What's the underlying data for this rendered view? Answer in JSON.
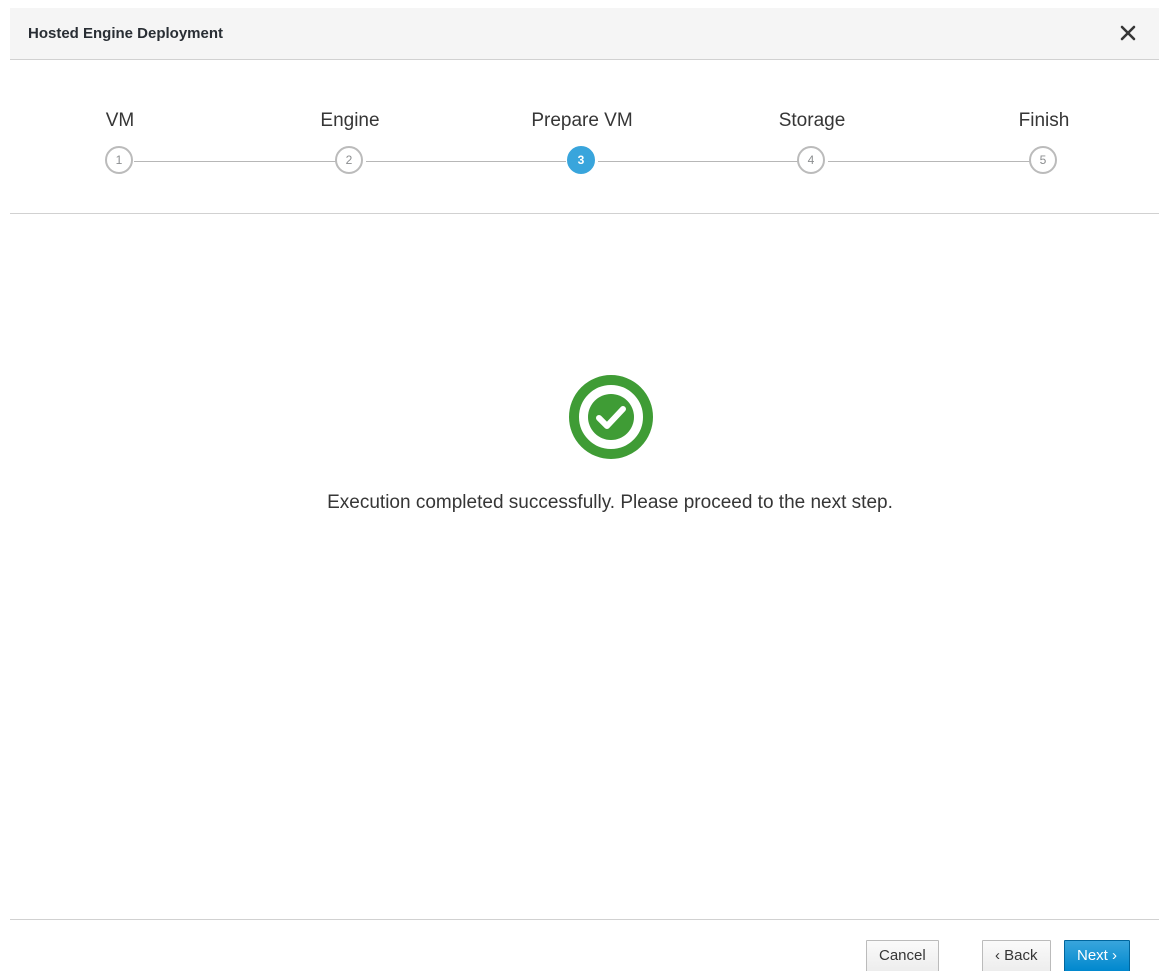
{
  "dialog": {
    "title": "Hosted Engine Deployment",
    "close_icon": "close-icon"
  },
  "wizard": {
    "active_step": 3,
    "steps": [
      {
        "number": "1",
        "label": "VM"
      },
      {
        "number": "2",
        "label": "Engine"
      },
      {
        "number": "3",
        "label": "Prepare VM"
      },
      {
        "number": "4",
        "label": "Storage"
      },
      {
        "number": "5",
        "label": "Finish"
      }
    ]
  },
  "content": {
    "status_icon": "check-circle-icon",
    "message": "Execution completed successfully. Please proceed to the next step."
  },
  "footer": {
    "cancel_label": "Cancel",
    "back_label": "‹ Back",
    "next_label": "Next ›"
  },
  "colors": {
    "accent": "#39a5dc",
    "success": "#3f9c35",
    "primary_button": "#0088ce"
  }
}
